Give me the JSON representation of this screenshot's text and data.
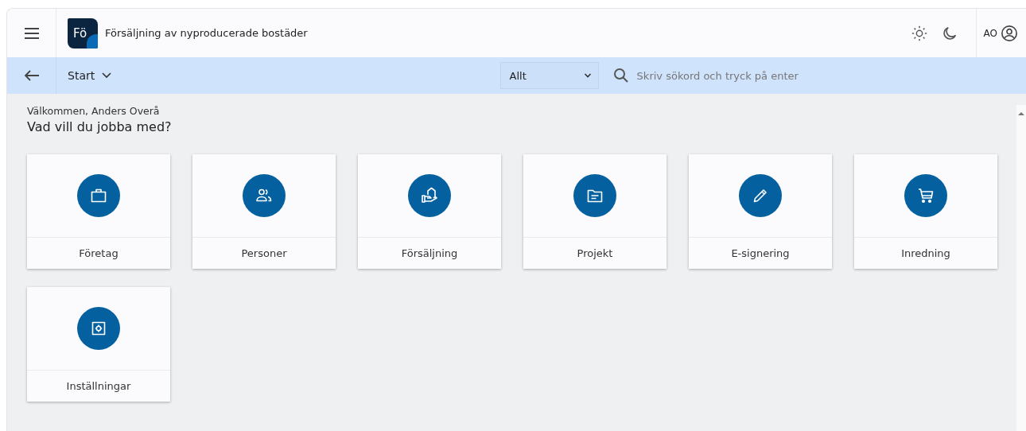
{
  "app": {
    "logo": "Fö",
    "title": "Försäljning av nyproducerade bostäder",
    "user_initials": "AO"
  },
  "nav": {
    "breadcrumb": "Start",
    "scope": "Allt",
    "search": {
      "placeholder": "Skriv sökord och tryck på enter"
    }
  },
  "welcome": "Välkommen, Anders Overå",
  "heading": "Vad vill du jobba med?",
  "tiles": [
    {
      "label": "Företag"
    },
    {
      "label": "Personer"
    },
    {
      "label": "Försäljning"
    },
    {
      "label": "Projekt"
    },
    {
      "label": "E-signering"
    },
    {
      "label": "Inredning"
    },
    {
      "label": "Inställningar"
    }
  ]
}
